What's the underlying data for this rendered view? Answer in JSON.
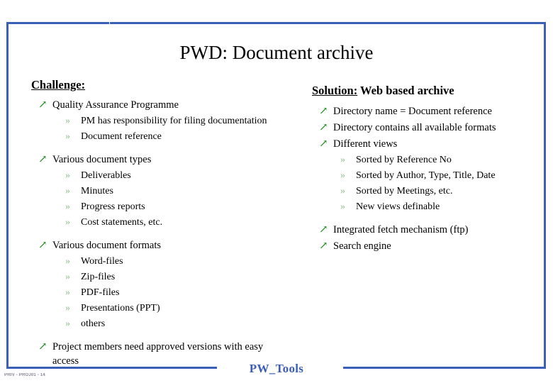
{
  "slide": {
    "title": "PWD: Document archive",
    "footer_label": "PW_Tools",
    "footer_code": "PRIV - PROJ01 - 14",
    "accent_color": "#3a5fb8",
    "bullet_arrow_color": "#1a8a1a",
    "bullet_sub_color": "#8fbf8f",
    "title_color": "#000000"
  },
  "left_column": {
    "heading_underlined": "Challenge:",
    "heading_plain": "",
    "items": [
      {
        "level": 1,
        "marker": "arrow-up-right-icon",
        "text": "Quality Assurance Programme"
      },
      {
        "level": 2,
        "marker": "guillemet-icon",
        "text": "PM has responsibility for filing documentation"
      },
      {
        "level": 2,
        "marker": "guillemet-icon",
        "text": "Document reference"
      },
      {
        "level": 1,
        "marker": "arrow-up-right-icon",
        "text": "Various document types"
      },
      {
        "level": 2,
        "marker": "guillemet-icon",
        "text": "Deliverables"
      },
      {
        "level": 2,
        "marker": "guillemet-icon",
        "text": "Minutes"
      },
      {
        "level": 2,
        "marker": "guillemet-icon",
        "text": "Progress reports"
      },
      {
        "level": 2,
        "marker": "guillemet-icon",
        "text": "Cost statements, etc."
      },
      {
        "level": 1,
        "marker": "arrow-up-right-icon",
        "text": "Various document formats"
      },
      {
        "level": 2,
        "marker": "guillemet-icon",
        "text": "Word-files"
      },
      {
        "level": 2,
        "marker": "guillemet-icon",
        "text": "Zip-files"
      },
      {
        "level": 2,
        "marker": "guillemet-icon",
        "text": "PDF-files"
      },
      {
        "level": 2,
        "marker": "guillemet-icon",
        "text": "Presentations (PPT)"
      },
      {
        "level": 2,
        "marker": "guillemet-icon",
        "text": "others"
      },
      {
        "level": 1,
        "marker": "arrow-up-right-icon",
        "text": "Project members need approved versions with easy access"
      }
    ]
  },
  "right_column": {
    "heading_underlined": "Solution:",
    "heading_plain": " Web based archive",
    "items": [
      {
        "level": 1,
        "marker": "arrow-up-right-icon",
        "text": "Directory name = Document reference"
      },
      {
        "level": 1,
        "marker": "arrow-up-right-icon",
        "text": "Directory contains all available formats"
      },
      {
        "level": 1,
        "marker": "arrow-up-right-icon",
        "text": "Different views"
      },
      {
        "level": 2,
        "marker": "guillemet-icon",
        "text": "Sorted by Reference No"
      },
      {
        "level": 2,
        "marker": "guillemet-icon",
        "text": "Sorted by Author, Type, Title, Date"
      },
      {
        "level": 2,
        "marker": "guillemet-icon",
        "text": "Sorted by Meetings, etc."
      },
      {
        "level": 2,
        "marker": "guillemet-icon",
        "text": "New views definable"
      },
      {
        "level": 1,
        "marker": "arrow-up-right-icon",
        "text": "Integrated fetch mechanism (ftp)"
      },
      {
        "level": 1,
        "marker": "arrow-up-right-icon",
        "text": "Search engine"
      }
    ]
  },
  "glyphs": {
    "arrow": "↗",
    "guillemet": "»"
  }
}
